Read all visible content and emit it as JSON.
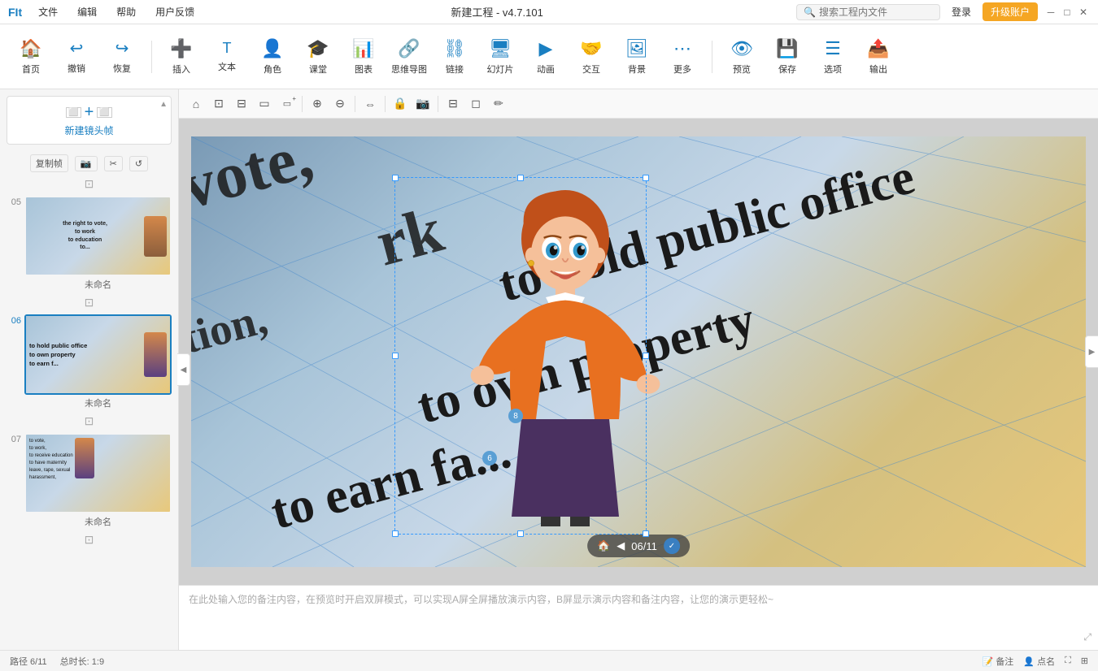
{
  "titlebar": {
    "app": "FIt",
    "title": "新建工程 - v4.7.101",
    "search_placeholder": "搜索工程内文件",
    "login": "登录",
    "upgrade": "升级账户",
    "menus": [
      "文件",
      "编辑",
      "帮助",
      "用户反馈"
    ]
  },
  "toolbar": {
    "home": "首页",
    "undo": "撤销",
    "redo": "恢复",
    "insert": "插入",
    "text": "文本",
    "character": "角色",
    "classroom": "课堂",
    "chart": "图表",
    "mindmap": "思维导图",
    "link": "链接",
    "slide": "幻灯片",
    "animation": "动画",
    "interact": "交互",
    "background": "背景",
    "more": "更多",
    "preview": "预览",
    "save": "保存",
    "options": "选项",
    "export": "输出"
  },
  "sidebar": {
    "new_frame": "新建镜头帧",
    "copy_btn": "复制帧",
    "slides": [
      {
        "number": "05",
        "label": "未命名",
        "texts": [
          "the right to vote,",
          "to work",
          "to education",
          "to..."
        ]
      },
      {
        "number": "06",
        "label": "未命名",
        "texts": [
          "to hold public office",
          "to own property",
          "to earn f..."
        ],
        "active": true
      },
      {
        "number": "07",
        "label": "未命名",
        "texts": [
          "to vote,",
          "to work,",
          "to receive education",
          "to have maternity",
          "leave, rape, sexual",
          "harassment,"
        ]
      }
    ]
  },
  "canvas": {
    "slide_text_lines": [
      "vote,",
      "rk",
      "tion,",
      "to hold public office",
      "to own property",
      "to earn fa..."
    ],
    "badge_8": "8",
    "badge_6": "6",
    "nav_current": "06",
    "nav_total": "11"
  },
  "notes": {
    "placeholder": "在此处输入您的备注内容，在预览时开启双屏模式，可以实现A屏全屏播放演示内容，B屏显示演示内容和备注内容，让您的演示更轻松~"
  },
  "statusbar": {
    "path": "路径 6/11",
    "duration": "总时长: 1:9",
    "note_label": "备注",
    "dot_label": "点名"
  },
  "actionbar": {
    "icons": [
      "⌂",
      "⊡",
      "⊟",
      "▭",
      "▭+",
      "⊕",
      "⊖",
      "⇔",
      "🔒",
      "📷",
      "◻",
      "✏"
    ]
  }
}
